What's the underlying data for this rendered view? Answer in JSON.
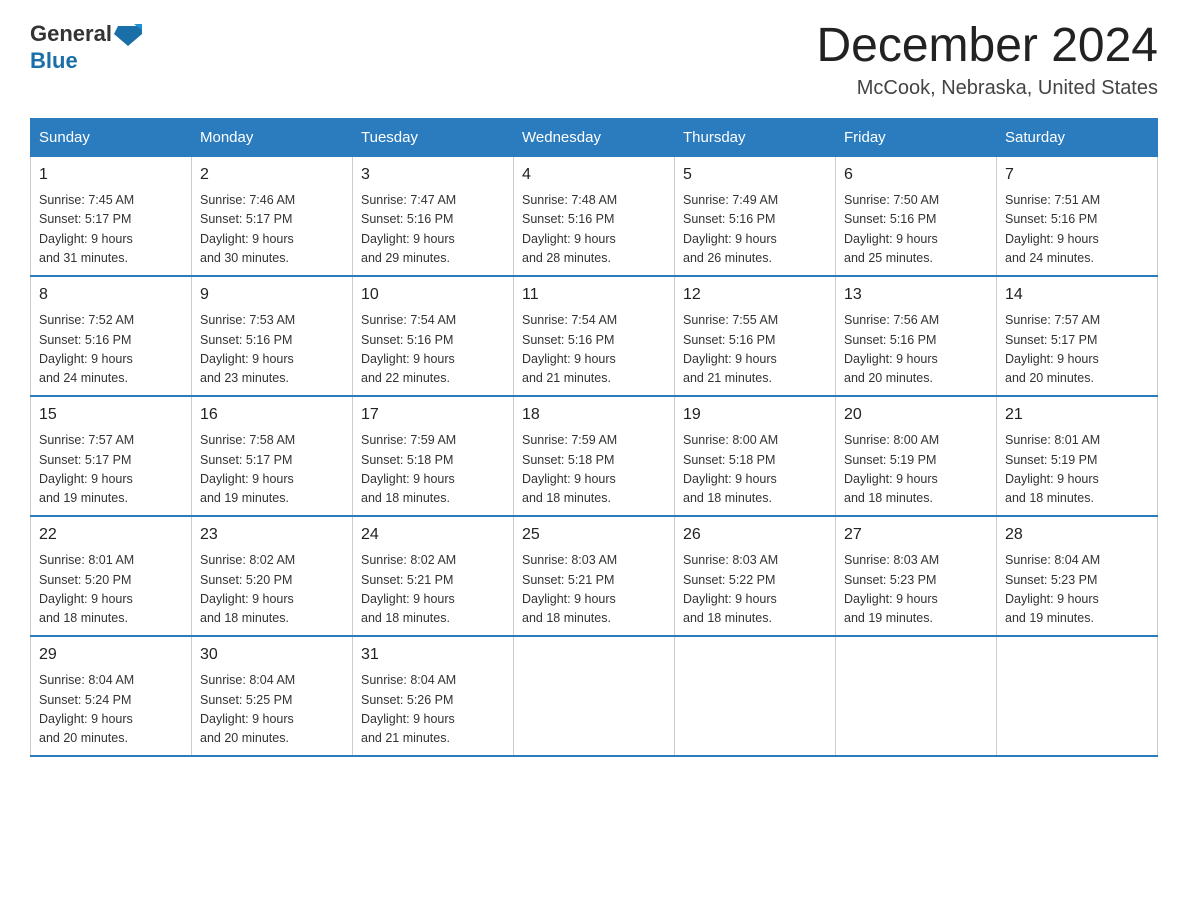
{
  "header": {
    "logo_text_general": "General",
    "logo_text_blue": "Blue",
    "month_title": "December 2024",
    "location": "McCook, Nebraska, United States"
  },
  "days_of_week": [
    "Sunday",
    "Monday",
    "Tuesday",
    "Wednesday",
    "Thursday",
    "Friday",
    "Saturday"
  ],
  "weeks": [
    [
      {
        "day": "1",
        "sunrise": "7:45 AM",
        "sunset": "5:17 PM",
        "daylight": "9 hours and 31 minutes."
      },
      {
        "day": "2",
        "sunrise": "7:46 AM",
        "sunset": "5:17 PM",
        "daylight": "9 hours and 30 minutes."
      },
      {
        "day": "3",
        "sunrise": "7:47 AM",
        "sunset": "5:16 PM",
        "daylight": "9 hours and 29 minutes."
      },
      {
        "day": "4",
        "sunrise": "7:48 AM",
        "sunset": "5:16 PM",
        "daylight": "9 hours and 28 minutes."
      },
      {
        "day": "5",
        "sunrise": "7:49 AM",
        "sunset": "5:16 PM",
        "daylight": "9 hours and 26 minutes."
      },
      {
        "day": "6",
        "sunrise": "7:50 AM",
        "sunset": "5:16 PM",
        "daylight": "9 hours and 25 minutes."
      },
      {
        "day": "7",
        "sunrise": "7:51 AM",
        "sunset": "5:16 PM",
        "daylight": "9 hours and 24 minutes."
      }
    ],
    [
      {
        "day": "8",
        "sunrise": "7:52 AM",
        "sunset": "5:16 PM",
        "daylight": "9 hours and 24 minutes."
      },
      {
        "day": "9",
        "sunrise": "7:53 AM",
        "sunset": "5:16 PM",
        "daylight": "9 hours and 23 minutes."
      },
      {
        "day": "10",
        "sunrise": "7:54 AM",
        "sunset": "5:16 PM",
        "daylight": "9 hours and 22 minutes."
      },
      {
        "day": "11",
        "sunrise": "7:54 AM",
        "sunset": "5:16 PM",
        "daylight": "9 hours and 21 minutes."
      },
      {
        "day": "12",
        "sunrise": "7:55 AM",
        "sunset": "5:16 PM",
        "daylight": "9 hours and 21 minutes."
      },
      {
        "day": "13",
        "sunrise": "7:56 AM",
        "sunset": "5:16 PM",
        "daylight": "9 hours and 20 minutes."
      },
      {
        "day": "14",
        "sunrise": "7:57 AM",
        "sunset": "5:17 PM",
        "daylight": "9 hours and 20 minutes."
      }
    ],
    [
      {
        "day": "15",
        "sunrise": "7:57 AM",
        "sunset": "5:17 PM",
        "daylight": "9 hours and 19 minutes."
      },
      {
        "day": "16",
        "sunrise": "7:58 AM",
        "sunset": "5:17 PM",
        "daylight": "9 hours and 19 minutes."
      },
      {
        "day": "17",
        "sunrise": "7:59 AM",
        "sunset": "5:18 PM",
        "daylight": "9 hours and 18 minutes."
      },
      {
        "day": "18",
        "sunrise": "7:59 AM",
        "sunset": "5:18 PM",
        "daylight": "9 hours and 18 minutes."
      },
      {
        "day": "19",
        "sunrise": "8:00 AM",
        "sunset": "5:18 PM",
        "daylight": "9 hours and 18 minutes."
      },
      {
        "day": "20",
        "sunrise": "8:00 AM",
        "sunset": "5:19 PM",
        "daylight": "9 hours and 18 minutes."
      },
      {
        "day": "21",
        "sunrise": "8:01 AM",
        "sunset": "5:19 PM",
        "daylight": "9 hours and 18 minutes."
      }
    ],
    [
      {
        "day": "22",
        "sunrise": "8:01 AM",
        "sunset": "5:20 PM",
        "daylight": "9 hours and 18 minutes."
      },
      {
        "day": "23",
        "sunrise": "8:02 AM",
        "sunset": "5:20 PM",
        "daylight": "9 hours and 18 minutes."
      },
      {
        "day": "24",
        "sunrise": "8:02 AM",
        "sunset": "5:21 PM",
        "daylight": "9 hours and 18 minutes."
      },
      {
        "day": "25",
        "sunrise": "8:03 AM",
        "sunset": "5:21 PM",
        "daylight": "9 hours and 18 minutes."
      },
      {
        "day": "26",
        "sunrise": "8:03 AM",
        "sunset": "5:22 PM",
        "daylight": "9 hours and 18 minutes."
      },
      {
        "day": "27",
        "sunrise": "8:03 AM",
        "sunset": "5:23 PM",
        "daylight": "9 hours and 19 minutes."
      },
      {
        "day": "28",
        "sunrise": "8:04 AM",
        "sunset": "5:23 PM",
        "daylight": "9 hours and 19 minutes."
      }
    ],
    [
      {
        "day": "29",
        "sunrise": "8:04 AM",
        "sunset": "5:24 PM",
        "daylight": "9 hours and 20 minutes."
      },
      {
        "day": "30",
        "sunrise": "8:04 AM",
        "sunset": "5:25 PM",
        "daylight": "9 hours and 20 minutes."
      },
      {
        "day": "31",
        "sunrise": "8:04 AM",
        "sunset": "5:26 PM",
        "daylight": "9 hours and 21 minutes."
      },
      null,
      null,
      null,
      null
    ]
  ],
  "labels": {
    "sunrise_prefix": "Sunrise: ",
    "sunset_prefix": "Sunset: ",
    "daylight_prefix": "Daylight: "
  }
}
